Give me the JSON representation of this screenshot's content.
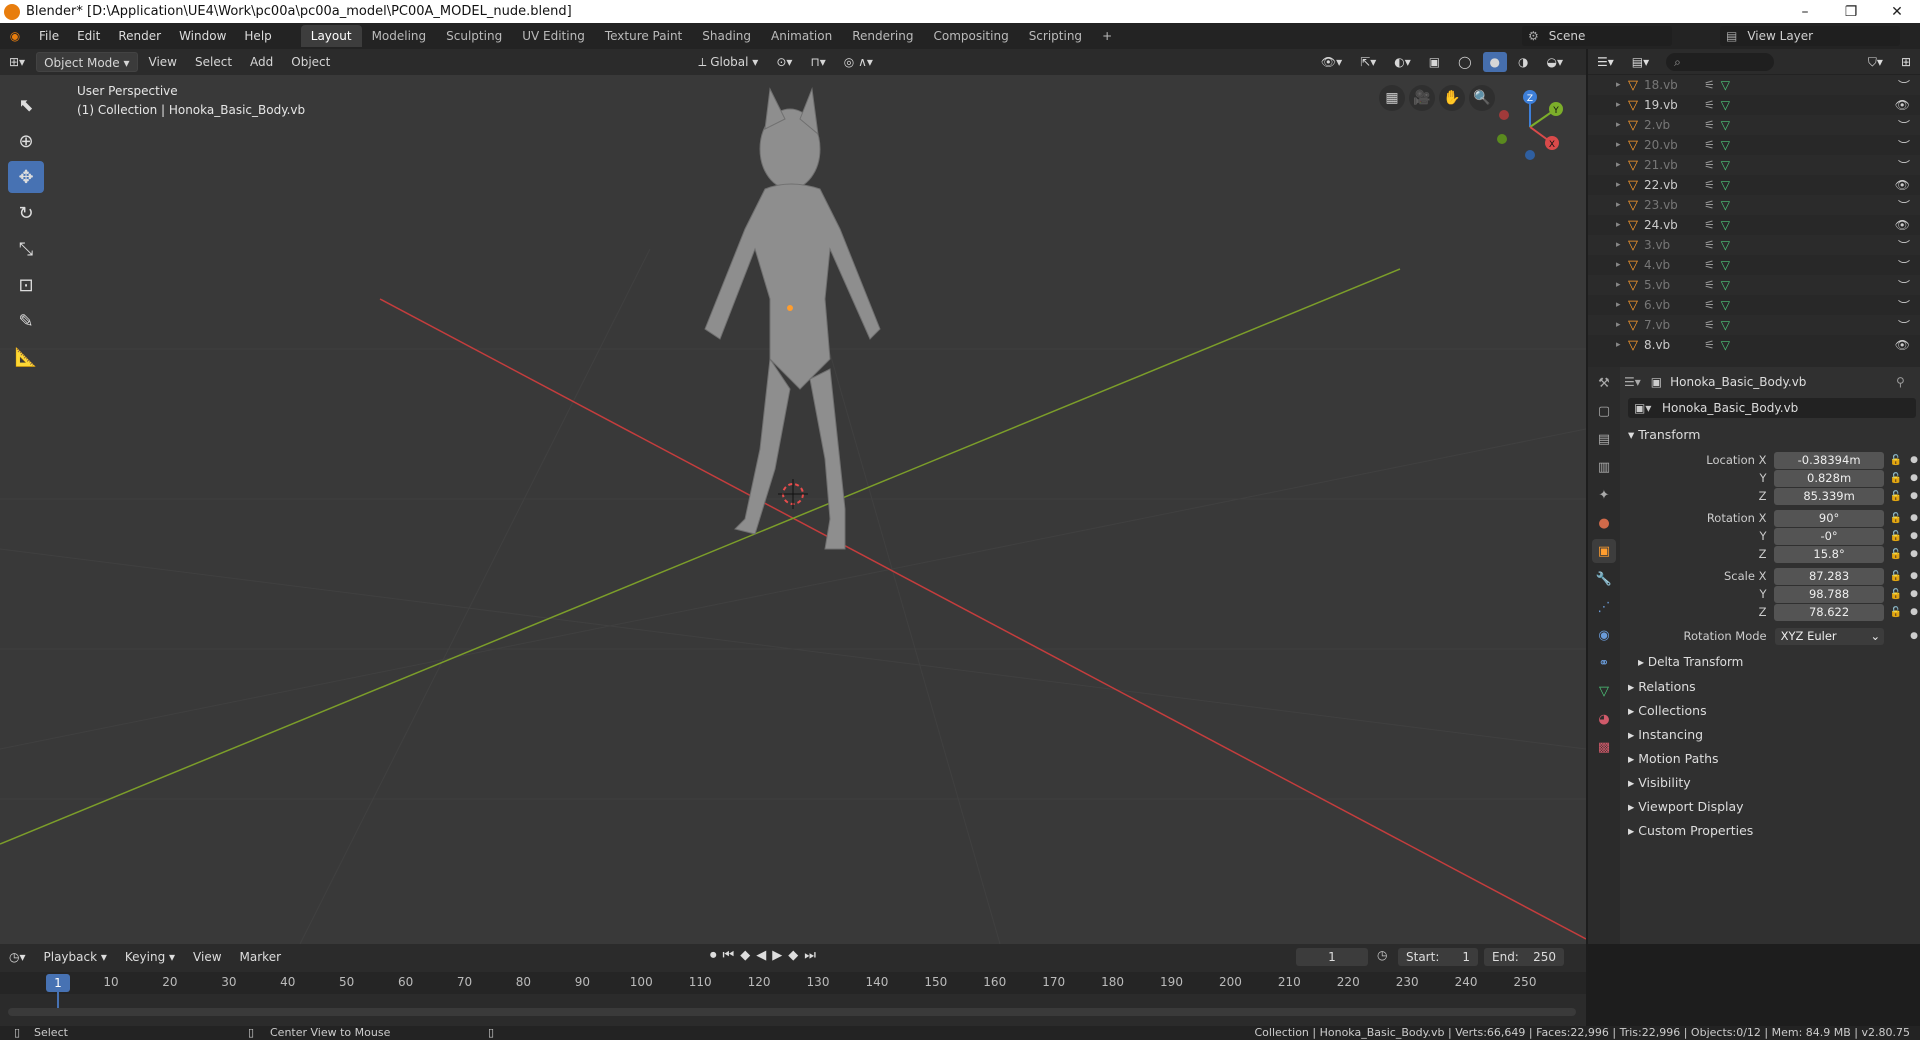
{
  "titlebar": {
    "title": "Blender* [D:\\Application\\UE4\\Work\\pc00a\\pc00a_model\\PC00A_MODEL_nude.blend]"
  },
  "menu": [
    "File",
    "Edit",
    "Render",
    "Window",
    "Help"
  ],
  "workspaces": [
    "Layout",
    "Modeling",
    "Sculpting",
    "UV Editing",
    "Texture Paint",
    "Shading",
    "Animation",
    "Rendering",
    "Compositing",
    "Scripting",
    "+"
  ],
  "scene": {
    "label": "Scene",
    "view_layer": "View Layer"
  },
  "viewport": {
    "mode": "Object Mode",
    "menus": [
      "View",
      "Select",
      "Add",
      "Object"
    ],
    "orientation": "Global",
    "overlay_line1": "User Perspective",
    "overlay_line2": "(1) Collection | Honoka_Basic_Body.vb",
    "gizmo": {
      "x": "X",
      "y": "Y",
      "z": "Z"
    }
  },
  "outliner": {
    "rows": [
      {
        "name": "18.vb",
        "visible": false
      },
      {
        "name": "19.vb",
        "visible": true
      },
      {
        "name": "2.vb",
        "visible": false
      },
      {
        "name": "20.vb",
        "visible": false
      },
      {
        "name": "21.vb",
        "visible": false
      },
      {
        "name": "22.vb",
        "visible": true
      },
      {
        "name": "23.vb",
        "visible": false
      },
      {
        "name": "24.vb",
        "visible": true
      },
      {
        "name": "3.vb",
        "visible": false
      },
      {
        "name": "4.vb",
        "visible": false
      },
      {
        "name": "5.vb",
        "visible": false
      },
      {
        "name": "6.vb",
        "visible": false
      },
      {
        "name": "7.vb",
        "visible": false
      },
      {
        "name": "8.vb",
        "visible": true
      }
    ]
  },
  "properties": {
    "object_name": "Honoka_Basic_Body.vb",
    "object_field": "Honoka_Basic_Body.vb",
    "transform_label": "Transform",
    "location": {
      "label": "Location X",
      "x": "-0.38394m",
      "y": "0.828m",
      "z": "85.339m"
    },
    "rotation": {
      "label": "Rotation X",
      "x": "90°",
      "y": "-0°",
      "z": "15.8°"
    },
    "scale": {
      "label": "Scale X",
      "x": "87.283",
      "y": "98.788",
      "z": "78.622"
    },
    "axis_y": "Y",
    "axis_z": "Z",
    "rotation_mode_label": "Rotation Mode",
    "rotation_mode": "XYZ Euler",
    "delta": "Delta Transform",
    "sections": [
      "Relations",
      "Collections",
      "Instancing",
      "Motion Paths",
      "Visibility",
      "Viewport Display",
      "Custom Properties"
    ]
  },
  "timeline": {
    "menus": [
      "Playback",
      "Keying",
      "View",
      "Marker"
    ],
    "current": "1",
    "start_label": "Start:",
    "start": "1",
    "end_label": "End:",
    "end": "250",
    "ticks": [
      "1",
      "10",
      "20",
      "30",
      "40",
      "50",
      "60",
      "70",
      "80",
      "90",
      "100",
      "110",
      "120",
      "130",
      "140",
      "150",
      "160",
      "170",
      "180",
      "190",
      "200",
      "210",
      "220",
      "230",
      "240",
      "250"
    ]
  },
  "status": {
    "left": "Select",
    "middle": "Center View to Mouse",
    "right": "Collection | Honoka_Basic_Body.vb | Verts:66,649 | Faces:22,996 | Tris:22,996 | Objects:0/12 | Mem: 84.9 MB | v2.80.75"
  },
  "colors": {
    "accent": "#4772b3",
    "x_axis": "#c43d3d",
    "y_axis": "#7c9e2a",
    "object": "#ff9d2e"
  }
}
